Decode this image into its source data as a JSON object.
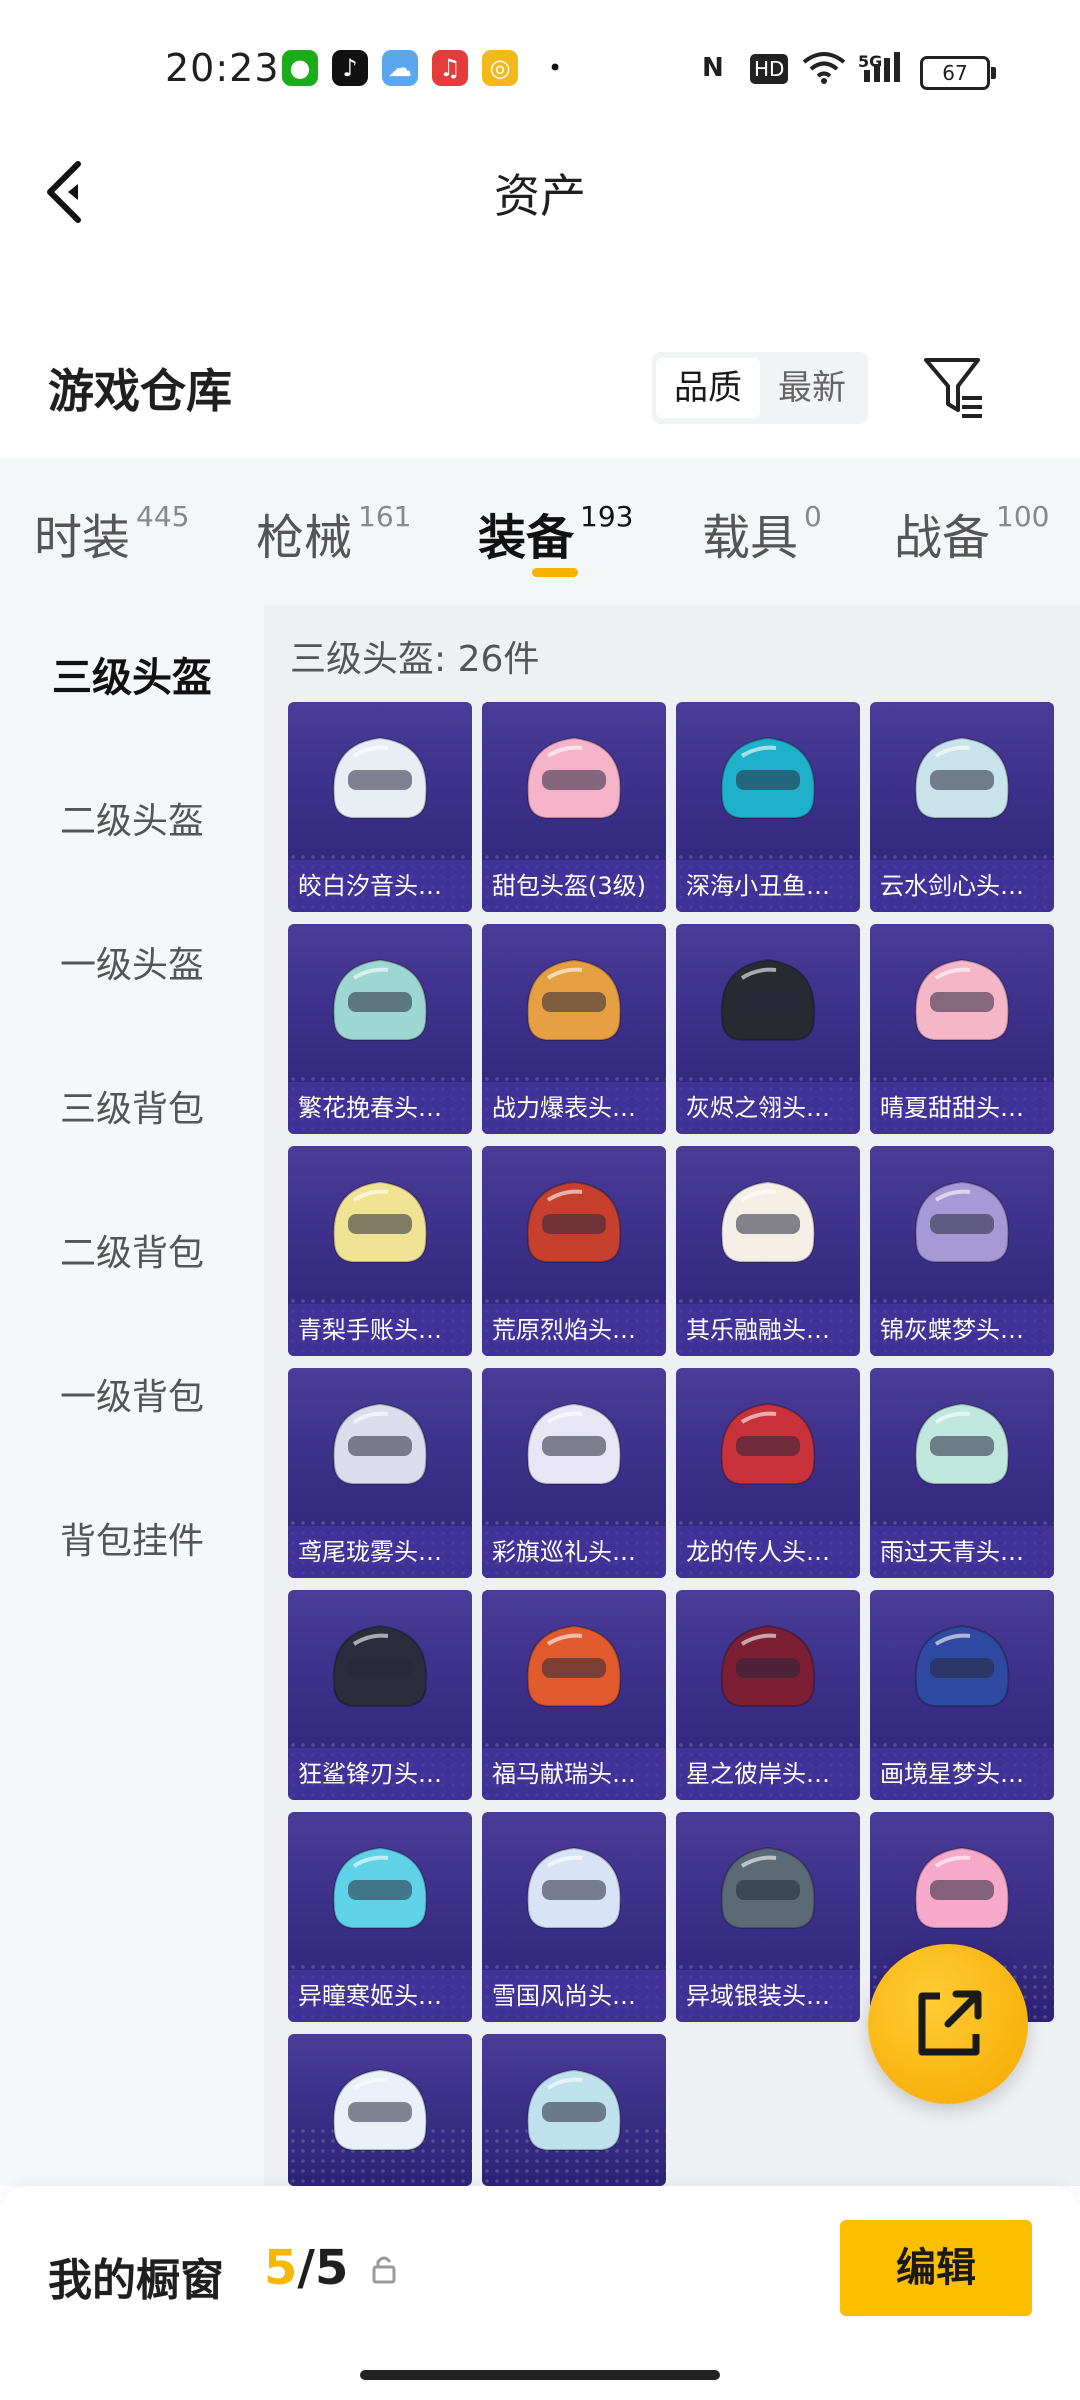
{
  "status_bar": {
    "time": "20:23",
    "apps": [
      "wechat-icon",
      "tiktok-icon",
      "weather-icon",
      "music-icon",
      "game-icon"
    ],
    "nfc": "N",
    "hd": "HD",
    "signal": "5G",
    "battery": "67"
  },
  "header": {
    "title": "资产"
  },
  "warehouse": {
    "title": "游戏仓库",
    "sort_options": [
      "品质",
      "最新"
    ],
    "selected_sort": "品质"
  },
  "tabs": [
    {
      "label": "时装",
      "count": "445"
    },
    {
      "label": "枪械",
      "count": "161"
    },
    {
      "label": "装备",
      "count": "193"
    },
    {
      "label": "载具",
      "count": "0"
    },
    {
      "label": "战备",
      "count": "100"
    }
  ],
  "active_tab": "装备",
  "sidebar": {
    "items": [
      {
        "label": "三级头盔"
      },
      {
        "label": "二级头盔"
      },
      {
        "label": "一级头盔"
      },
      {
        "label": "三级背包"
      },
      {
        "label": "二级背包"
      },
      {
        "label": "一级背包"
      },
      {
        "label": "背包挂件"
      }
    ],
    "selected": "三级头盔"
  },
  "grid": {
    "header": "三级头盔: 26件",
    "items": [
      {
        "name": "皎白汐音头盔...",
        "color": "#e9eef5"
      },
      {
        "name": "甜包头盔(3级)",
        "color": "#f4b3c9"
      },
      {
        "name": "深海小丑鱼头...",
        "color": "#1fb1c9"
      },
      {
        "name": "云水剑心头盔...",
        "color": "#c8e3ea"
      },
      {
        "name": "繁花挽春头盔...",
        "color": "#9ed7d2"
      },
      {
        "name": "战力爆表头盔...",
        "color": "#e6a043"
      },
      {
        "name": "灰烬之翎头盔...",
        "color": "#2a2a33"
      },
      {
        "name": "晴夏甜甜头盔...",
        "color": "#f5b6c8"
      },
      {
        "name": "青梨手账头盔...",
        "color": "#f1e394"
      },
      {
        "name": "荒原烈焰头盔...",
        "color": "#c6402d"
      },
      {
        "name": "其乐融融头盔...",
        "color": "#f4efe6"
      },
      {
        "name": "锦灰蝶梦头盔...",
        "color": "#a59ad6"
      },
      {
        "name": "鸢尾珑雾头盔...",
        "color": "#dcdcec"
      },
      {
        "name": "彩旗巡礼头盔...",
        "color": "#e8e6f4"
      },
      {
        "name": "龙的传人头盔...",
        "color": "#c9323a"
      },
      {
        "name": "雨过天青头盔...",
        "color": "#bfe7dd"
      },
      {
        "name": "狂鲨锋刃头盔...",
        "color": "#2b2d3c"
      },
      {
        "name": "福马献瑞头盔...",
        "color": "#e25b2e"
      },
      {
        "name": "星之彼岸头盔...",
        "color": "#7c1e34"
      },
      {
        "name": "画境星梦头盔...",
        "color": "#2f4aa0"
      },
      {
        "name": "异瞳寒姬头盔...",
        "color": "#5fd2e8"
      },
      {
        "name": "雪国风尚头盔...",
        "color": "#d9e3f6"
      },
      {
        "name": "异域银装头盔...",
        "color": "#5b6a74"
      },
      {
        "name": "",
        "color": "#f6a9c8"
      },
      {
        "name": "",
        "color": "#e9f0f8"
      },
      {
        "name": "",
        "color": "#bfe1ee"
      }
    ]
  },
  "bottom_bar": {
    "label": "我的橱窗",
    "count_current": "5",
    "count_sep": "/",
    "count_total": "5",
    "edit_label": "编辑"
  }
}
